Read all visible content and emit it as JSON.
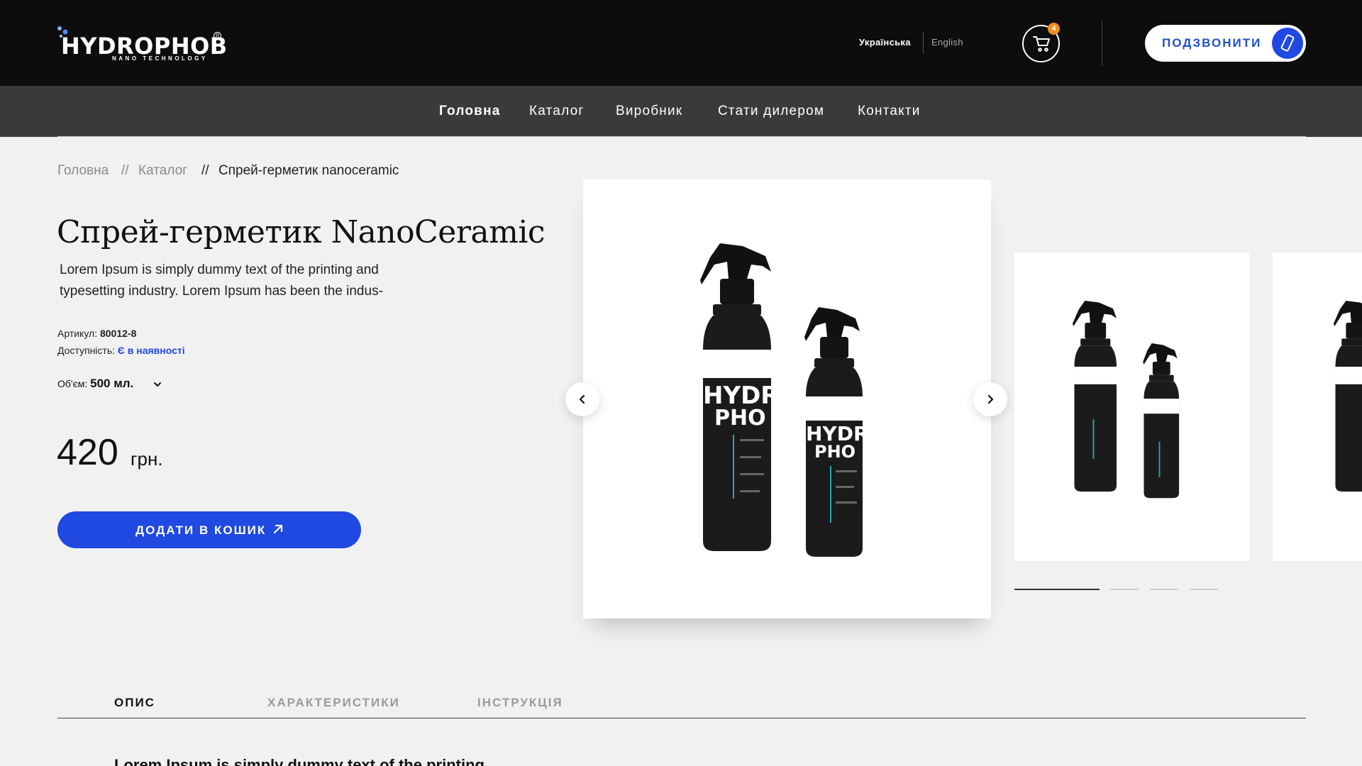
{
  "header": {
    "logo": {
      "name": "HYDROPHOB",
      "tagline": "NANO TECHNOLOGY",
      "reg_mark": "R"
    },
    "languages": [
      {
        "label": "Українська",
        "active": true
      },
      {
        "label": "English",
        "active": false
      }
    ],
    "cart": {
      "count": "4",
      "icon": "cart-icon"
    },
    "call_button": {
      "label": "ПОДЗВОНИТИ",
      "icon": "phone-icon"
    }
  },
  "nav": {
    "items": [
      {
        "label": "Головна",
        "active": true
      },
      {
        "label": "Каталог",
        "active": false
      },
      {
        "label": "Виробник",
        "active": false
      },
      {
        "label": "Стати дилером",
        "active": false
      },
      {
        "label": "Контакти",
        "active": false
      }
    ]
  },
  "breadcrumb": {
    "items": [
      "Головна",
      "Каталог",
      "Спрей-герметик nanoceramic"
    ],
    "separator": "//"
  },
  "product": {
    "title": "Спрей-герметик NanoCeramic",
    "description": "Lorem Ipsum is simply dummy text of the printing and typesetting industry. Lorem Ipsum has been the indus-",
    "sku_label": "Артикул:",
    "sku": "80012-8",
    "availability_label": "Доступність:",
    "availability": "Є в наявності",
    "volume_label": "Об'єм:",
    "volume": "500 мл.",
    "price": "420",
    "currency": "грн.",
    "add_to_cart": "ДОДАТИ В КОШИК",
    "bottle_label_short": "HYDR",
    "bottle_label_short2": "PHO"
  },
  "gallery": {
    "slides_total": 4,
    "active_slide": 1
  },
  "tabs": {
    "items": [
      {
        "label": "ОПИС",
        "active": true
      },
      {
        "label": "ХАРАКТЕРИСТИКИ",
        "active": false
      },
      {
        "label": "ІНСТРУКЦІЯ",
        "active": false
      }
    ],
    "content_preview": "Lorem Ipsum is simply dummy text of the printing"
  },
  "colors": {
    "accent_blue": "#1f49e0",
    "badge_orange": "#f28d1c",
    "topbar": "#0d0d0d",
    "navbar": "#3a3a3a"
  }
}
